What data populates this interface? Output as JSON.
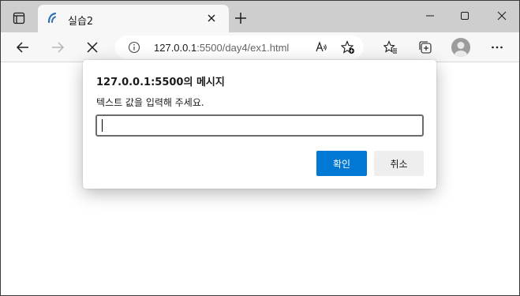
{
  "tab": {
    "title": "실습2",
    "favicon": "vscode-live-server-icon"
  },
  "toolbar": {
    "url_host": "127.0.0.1",
    "url_rest": ":5500/day4/ex1.html"
  },
  "dialog": {
    "title": "127.0.0.1:5500의 메시지",
    "message": "텍스트 값을 입력해 주세요.",
    "input_value": "",
    "ok_label": "확인",
    "cancel_label": "취소"
  },
  "colors": {
    "accent": "#0078d4",
    "titlebar": "#cecece",
    "toolbar": "#f7f7f7"
  }
}
